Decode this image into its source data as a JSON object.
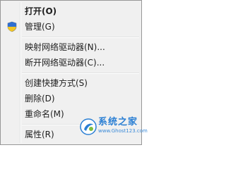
{
  "menu": {
    "items": [
      {
        "label": "打开(O)",
        "bold": true
      },
      {
        "label": "管理(G)",
        "icon": "uac-shield-icon"
      },
      {
        "label": "映射网络驱动器(N)..."
      },
      {
        "label": "断开网络驱动器(C)..."
      },
      {
        "label": "创建快捷方式(S)"
      },
      {
        "label": "删除(D)"
      },
      {
        "label": "重命名(M)"
      },
      {
        "label": "属性(R)"
      }
    ]
  },
  "watermark": {
    "title": "系统之家",
    "url": "www.Ghost123.com"
  },
  "colors": {
    "menu_background": "#f0f0f0",
    "border": "#979797",
    "watermark_blue": "#2a7fd4"
  }
}
